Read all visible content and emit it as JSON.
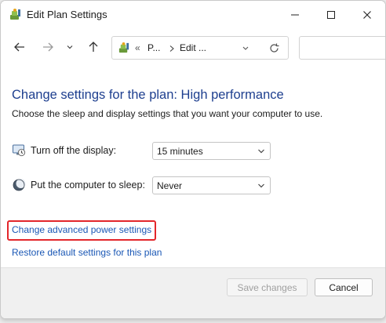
{
  "window": {
    "title": "Edit Plan Settings"
  },
  "address": {
    "overflow": "«",
    "crumb1": "P...",
    "crumb2": "Edit ..."
  },
  "main": {
    "heading": "Change settings for the plan: High performance",
    "subheading": "Choose the sleep and display settings that you want your computer to use.",
    "display": {
      "label": "Turn off the display:",
      "value": "15 minutes"
    },
    "sleep": {
      "label": "Put the computer to sleep:",
      "value": "Never"
    }
  },
  "links": {
    "advanced": "Change advanced power settings",
    "restore": "Restore default settings for this plan"
  },
  "buttons": {
    "save": "Save changes",
    "cancel": "Cancel"
  },
  "colors": {
    "heading": "#1e3f8f",
    "link": "#1a57b5",
    "highlight": "#e3262b"
  }
}
